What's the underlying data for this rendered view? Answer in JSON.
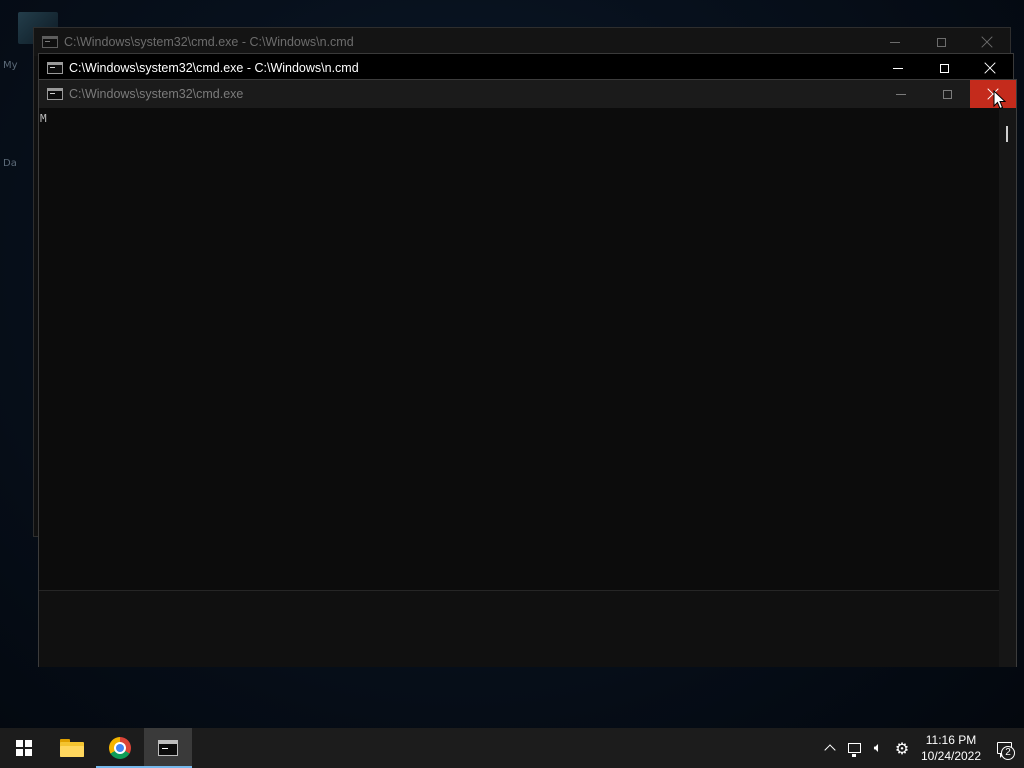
{
  "desktop": {
    "labels": [
      "My",
      "Da"
    ]
  },
  "windows": [
    {
      "title": "C:\\Windows\\system32\\cmd.exe - C:\\Windows\\n.cmd",
      "state": "background"
    },
    {
      "title": "C:\\Windows\\system32\\cmd.exe - C:\\Windows\\n.cmd",
      "state": "inactive"
    },
    {
      "title": "C:\\Windows\\system32\\cmd.exe",
      "state": "foreground",
      "console_output": "M",
      "close_hovered": true
    }
  ],
  "taskbar": {
    "apps": [
      {
        "icon": "windows-start-icon"
      },
      {
        "icon": "file-explorer-icon"
      },
      {
        "icon": "chrome-icon",
        "running": true
      },
      {
        "icon": "command-prompt-icon",
        "running": true,
        "active": true
      }
    ],
    "tray": {
      "icons": [
        "chevron-up-icon",
        "network-icon",
        "volume-icon",
        "settings-gear-icon"
      ],
      "time": "11:16 PM",
      "date": "10/24/2022",
      "notification_count": "2"
    }
  },
  "colors": {
    "close_hover": "#c42b1c",
    "taskbar": "#1c1c1c",
    "running_indicator": "#76b9ed",
    "console_bg": "#0c0c0c"
  }
}
